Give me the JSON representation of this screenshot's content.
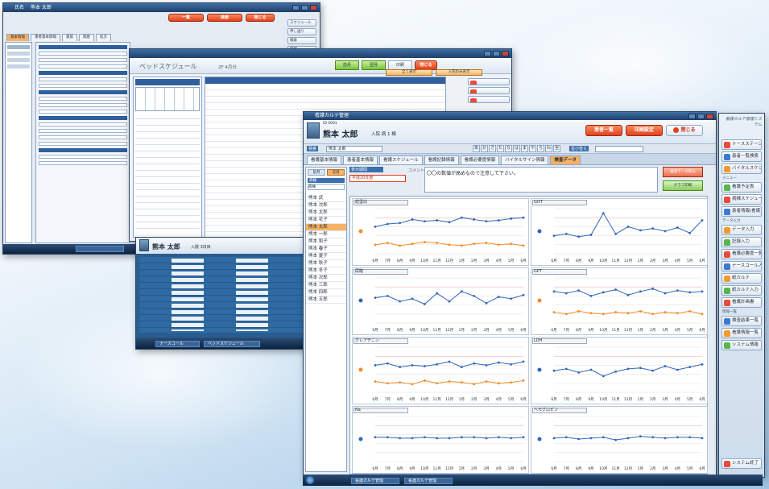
{
  "back_window": {
    "patient_label": "氏名",
    "patient_name": "熊本 太郎",
    "header_buttons": [
      "一覧",
      "検索",
      "閉じる"
    ],
    "tabs": [
      "基本情報",
      "患者基本情報",
      "家族",
      "病歴",
      "処方"
    ],
    "side_buttons": [
      "スケジュール",
      "申し送り",
      "検索",
      "印刷"
    ]
  },
  "schedule_window": {
    "title": "ベッドスケジュール",
    "subtitle": "2F 4月分",
    "buttons": [
      "前月",
      "翌月",
      "印刷",
      "閉じる"
    ],
    "filter_buttons": [
      "全て表示",
      "入院のみ表示"
    ]
  },
  "popup_window": {
    "patient_name": "熊本 太郎",
    "patient_meta": "入院 3日目",
    "taskbar_items": [
      "スタート",
      "ナースコール",
      "ベッドスケジュール"
    ]
  },
  "front_window": {
    "title": "看護カルテ管理",
    "patient_id_label": "ID 0001",
    "patient_name": "熊本 太郎",
    "patient_meta": "入院 病 1 棟",
    "header_buttons": {
      "list": "患者一覧",
      "print": "印刷設定",
      "close": "閉じる"
    },
    "search_label": "検索",
    "search_value": "熊本 太郎",
    "kana_buttons": [
      "あ",
      "か",
      "さ",
      "た",
      "な",
      "は",
      "ま",
      "や",
      "ら",
      "わ",
      "全"
    ],
    "sort_label": "並び替え",
    "tabs": [
      "看護基本情報",
      "患者基本情報",
      "看護スケジュール",
      "看護記録情報",
      "看護必要度情報",
      "バイタルサイン情報",
      "検査データ"
    ],
    "active_tab": "検査データ",
    "sub_buttons": [
      "前月",
      "次月"
    ],
    "filter_label": "病棟",
    "filter_value": "病棟",
    "period_label": "表示期間",
    "period_value": "平成20年度",
    "comment_label": "コメント",
    "comment_text": "〇〇の数値が高めなので注意して下さい。",
    "right_buttons": [
      "検査データ取込",
      "グラフ印刷"
    ],
    "patients": [
      "熊本 武",
      "熊本 次郎",
      "熊本 太郎",
      "熊本 花子",
      "熊本 太郎",
      "熊本 一郎",
      "熊本 和子",
      "熊本 春子",
      "熊本 夏子",
      "熊本 秋子",
      "熊本 冬子",
      "熊本 次郎",
      "熊本 三郎",
      "熊本 四郎",
      "熊本 五郎"
    ],
    "selected_patient_index": 4,
    "months": [
      "6月",
      "7月",
      "8月",
      "9月",
      "10月",
      "11月",
      "12月",
      "1月",
      "2月",
      "3月",
      "4月",
      "5月",
      "6月"
    ]
  },
  "chart_data": [
    {
      "type": "line",
      "title": "総蛋白",
      "series": [
        {
          "values": [
            30,
            33,
            34,
            38,
            36,
            37,
            35,
            40,
            38,
            36,
            37,
            39,
            40
          ]
        },
        {
          "values": [
            10,
            12,
            9,
            11,
            13,
            12,
            10,
            9,
            11,
            12,
            10,
            11,
            9
          ]
        }
      ]
    },
    {
      "type": "line",
      "title": "GOT",
      "series": [
        {
          "values": [
            20,
            22,
            19,
            21,
            45,
            22,
            30,
            26,
            28,
            25,
            29,
            23,
            37
          ]
        }
      ]
    },
    {
      "type": "line",
      "title": "尿酸",
      "series": [
        {
          "values": [
            28,
            30,
            24,
            27,
            21,
            33,
            24,
            35,
            30,
            22,
            29,
            27,
            31
          ]
        }
      ]
    },
    {
      "type": "line",
      "title": "GPT",
      "series": [
        {
          "values": [
            35,
            33,
            36,
            30,
            34,
            37,
            31,
            35,
            38,
            33,
            36,
            34,
            35
          ]
        },
        {
          "values": [
            12,
            10,
            13,
            11,
            10,
            12,
            11,
            13,
            10,
            12,
            11,
            13,
            10
          ]
        }
      ]
    },
    {
      "type": "line",
      "title": "クレアチニン",
      "series": [
        {
          "values": [
            30,
            32,
            28,
            30,
            29,
            31,
            34,
            28,
            32,
            30,
            33,
            31,
            34
          ]
        },
        {
          "values": [
            12,
            10,
            11,
            9,
            13,
            10,
            12,
            11,
            9,
            12,
            10,
            11,
            13
          ]
        }
      ]
    },
    {
      "type": "line",
      "title": "LDH",
      "series": [
        {
          "values": [
            24,
            26,
            22,
            25,
            18,
            23,
            26,
            27,
            24,
            29,
            25,
            28,
            31
          ]
        }
      ]
    },
    {
      "type": "line",
      "title": "Na",
      "series": [
        {
          "values": [
            27,
            27,
            26,
            26,
            27,
            26,
            26,
            27,
            27,
            26,
            27,
            26,
            27
          ]
        }
      ]
    },
    {
      "type": "line",
      "title": "ヘモグロビン",
      "series": [
        {
          "values": [
            26,
            27,
            25,
            26,
            27,
            24,
            26,
            28,
            27,
            26,
            27,
            27,
            26
          ]
        }
      ]
    }
  ],
  "sidebar": {
    "logo": "看護カルテ管理システム",
    "items": [
      "ナースステーション",
      "患者一覧検索",
      "バイタルスケジュール",
      "看護予定表",
      "病棟スケジュール",
      "患者情報(看護)",
      "データ入力",
      "記録入力",
      "看護必要度一覧",
      "ナースコール入力",
      "紙カルテ",
      "紙カルテ入力",
      "看護計画書",
      "検査結果一覧",
      "看護情報一覧",
      "システム情報"
    ],
    "sections": [
      "メニュー",
      "データ入力",
      "情報一覧"
    ],
    "exit": "システム終了"
  },
  "taskbar": {
    "items": [
      "看護カルテ管理",
      "看護カルテ管理"
    ]
  },
  "colors": {
    "blue_series": "#2f67b7",
    "orange_series": "#f28c28",
    "accent_red": "#e0411f",
    "active_tab": "#f7b268"
  }
}
